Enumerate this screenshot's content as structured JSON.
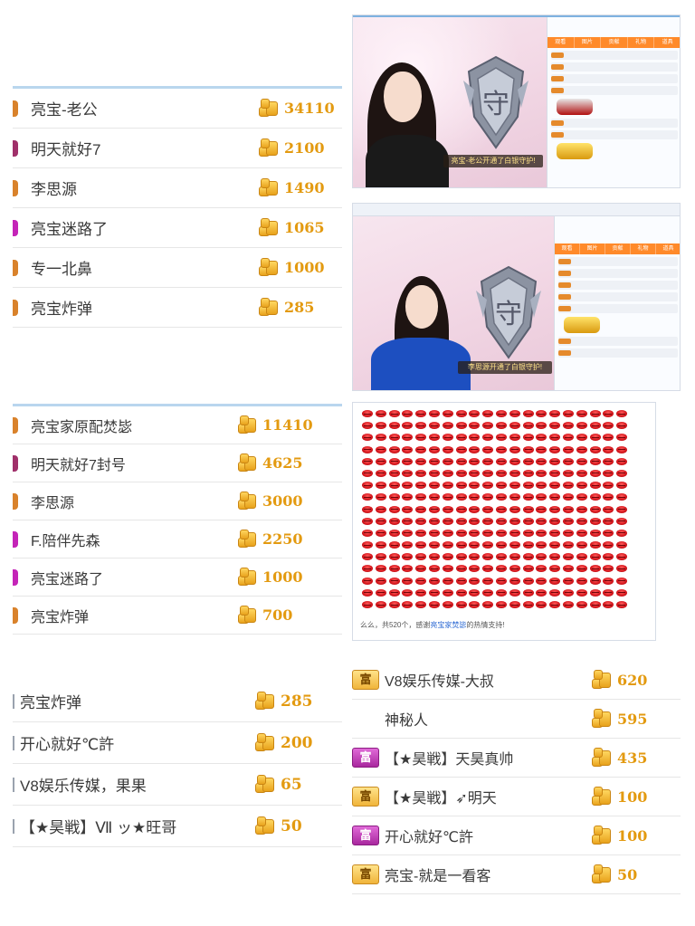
{
  "board1": {
    "rows": [
      {
        "name": "亮宝-老公",
        "amount": "34110",
        "stub": "#d9822b"
      },
      {
        "name": "明天就好7",
        "amount": "2100",
        "stub": "#a0306a"
      },
      {
        "name": "李思源",
        "amount": "1490",
        "stub": "#d9822b"
      },
      {
        "name": "亮宝迷路了",
        "amount": "1065",
        "stub": "#c424b8"
      },
      {
        "name": "专一北鼻",
        "amount": "1000",
        "stub": "#d9822b"
      },
      {
        "name": "亮宝炸弹",
        "amount": "285",
        "stub": "#d9822b"
      }
    ]
  },
  "board2": {
    "rows": [
      {
        "name": "亮宝家原配焚毖",
        "amount": "11410",
        "stub": "#d9822b"
      },
      {
        "name": "明天就好7封号",
        "amount": "4625",
        "stub": "#a0306a"
      },
      {
        "name": "李思源",
        "amount": "3000",
        "stub": "#d9822b"
      },
      {
        "name": "F.陪伴先森",
        "amount": "2250",
        "stub": "#c424b8"
      },
      {
        "name": "亮宝迷路了",
        "amount": "1000",
        "stub": "#c424b8"
      },
      {
        "name": "亮宝炸弹",
        "amount": "700",
        "stub": "#d9822b"
      }
    ]
  },
  "board3": {
    "rows": [
      {
        "name": "亮宝炸弹",
        "amount": "285"
      },
      {
        "name": "开心就好℃許",
        "amount": "200"
      },
      {
        "name": "V8娱乐传媒，果果",
        "amount": "65"
      },
      {
        "name": "【★昊戦】Ⅶ ッ★旺哥",
        "amount": "50"
      }
    ]
  },
  "board4": {
    "badge": "富",
    "rows": [
      {
        "name": "V8娱乐传媒-大叔",
        "amount": "620",
        "badge": "gold"
      },
      {
        "name": "神秘人",
        "amount": "595",
        "badge": "none"
      },
      {
        "name": "【★昊戦】天昊真帅",
        "amount": "435",
        "badge": "purple"
      },
      {
        "name": "【★昊戦】➶明天",
        "amount": "100",
        "badge": "gold"
      },
      {
        "name": "开心就好℃許",
        "amount": "100",
        "badge": "purple"
      },
      {
        "name": "亮宝-就是一看客",
        "amount": "50",
        "badge": "gold"
      }
    ]
  },
  "stream1": {
    "caption": "亮宝-老公开通了白银守护!",
    "emblem": "守",
    "tabs": [
      "观看",
      "图片",
      "贡献",
      "礼物",
      "道具"
    ]
  },
  "stream2": {
    "caption": "李思源开通了白银守护!",
    "emblem": "守",
    "tabs": [
      "观看",
      "图片",
      "贡献",
      "礼物",
      "道具"
    ]
  },
  "lips": {
    "count": 520,
    "footer_prefix": "么么，共520个，感谢",
    "footer_name": "亮宝家焚毖",
    "footer_suffix": "的热情支持!"
  },
  "colors": {
    "amount": "#e39a10",
    "border": "#e6e6e6",
    "accent_blue": "#b9d6ee",
    "chat_orange": "#ff8a2a"
  }
}
